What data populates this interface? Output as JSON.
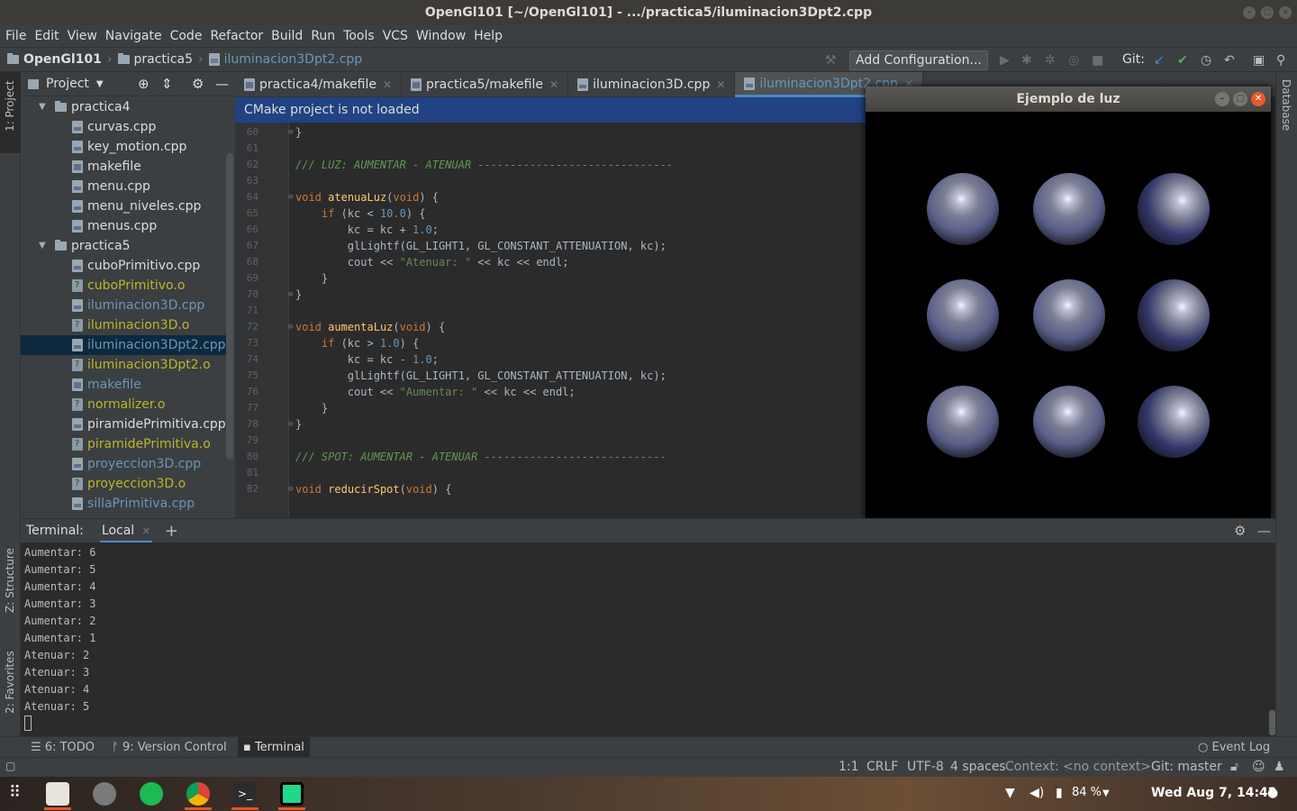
{
  "window": {
    "title": "OpenGl101 [~/OpenGl101] - .../practica5/iluminacion3Dpt2.cpp"
  },
  "menu": [
    "File",
    "Edit",
    "View",
    "Navigate",
    "Code",
    "Refactor",
    "Build",
    "Run",
    "Tools",
    "VCS",
    "Window",
    "Help"
  ],
  "breadcrumb": {
    "project": "OpenGl101",
    "folder": "practica5",
    "file": "iluminacion3Dpt2.cpp"
  },
  "toolbar": {
    "add_config": "Add Configuration...",
    "git_label": "Git:"
  },
  "side_tabs": {
    "project": "1: Project",
    "structure": "Z: Structure",
    "favorites": "2: Favorites",
    "database": "Database"
  },
  "project_panel": {
    "title": "Project",
    "tree": [
      {
        "label": "practica4",
        "kind": "folder",
        "color": "white",
        "depth": 0
      },
      {
        "label": "curvas.cpp",
        "kind": "cpp",
        "color": "white",
        "depth": 1
      },
      {
        "label": "key_motion.cpp",
        "kind": "cpp",
        "color": "white",
        "depth": 1
      },
      {
        "label": "makefile",
        "kind": "mk",
        "color": "white",
        "depth": 1
      },
      {
        "label": "menu.cpp",
        "kind": "cpp",
        "color": "white",
        "depth": 1
      },
      {
        "label": "menu_niveles.cpp",
        "kind": "cpp",
        "color": "white",
        "depth": 1
      },
      {
        "label": "menus.cpp",
        "kind": "cpp",
        "color": "white",
        "depth": 1
      },
      {
        "label": "practica5",
        "kind": "folder",
        "color": "white",
        "depth": 0
      },
      {
        "label": "cuboPrimitivo.cpp",
        "kind": "cpp",
        "color": "white",
        "depth": 1
      },
      {
        "label": "cuboPrimitivo.o",
        "kind": "obj",
        "color": "yellow",
        "depth": 1
      },
      {
        "label": "iluminacion3D.cpp",
        "kind": "cpp",
        "color": "blue",
        "depth": 1
      },
      {
        "label": "iluminacion3D.o",
        "kind": "obj",
        "color": "yellow",
        "depth": 1
      },
      {
        "label": "iluminacion3Dpt2.cpp",
        "kind": "cpp",
        "color": "blue",
        "depth": 1,
        "selected": true
      },
      {
        "label": "iluminacion3Dpt2.o",
        "kind": "obj",
        "color": "yellow",
        "depth": 1
      },
      {
        "label": "makefile",
        "kind": "mk",
        "color": "blue",
        "depth": 1
      },
      {
        "label": "normalizer.o",
        "kind": "obj",
        "color": "yellow",
        "depth": 1
      },
      {
        "label": "piramidePrimitiva.cpp",
        "kind": "cpp",
        "color": "white",
        "depth": 1
      },
      {
        "label": "piramidePrimitiva.o",
        "kind": "obj",
        "color": "yellow",
        "depth": 1
      },
      {
        "label": "proyeccion3D.cpp",
        "kind": "cpp",
        "color": "blue",
        "depth": 1
      },
      {
        "label": "proyeccion3D.o",
        "kind": "obj",
        "color": "yellow",
        "depth": 1
      },
      {
        "label": "sillaPrimitiva.cpp",
        "kind": "cpp",
        "color": "blue",
        "depth": 1
      }
    ]
  },
  "tabs": [
    {
      "label": "practica4/makefile",
      "active": false
    },
    {
      "label": "practica5/makefile",
      "active": false
    },
    {
      "label": "iluminacion3D.cpp",
      "active": false
    },
    {
      "label": "iluminacion3Dpt2.cpp",
      "active": true
    }
  ],
  "cmake_banner": "CMake project is not loaded",
  "editor": {
    "lines": [
      {
        "n": "60",
        "html": "}"
      },
      {
        "n": "61",
        "html": ""
      },
      {
        "n": "62",
        "html": "<span class='cmt'>/// LUZ: AUMENTAR - ATENUAR ------------------------------</span>"
      },
      {
        "n": "63",
        "html": ""
      },
      {
        "n": "64",
        "html": "<span class='kw'>void</span> <span class='fn'>atenuaLuz</span>(<span class='kw'>void</span>) {"
      },
      {
        "n": "65",
        "html": "    <span class='kw'>if</span> (kc &lt; <span class='num'>10.0</span>) {"
      },
      {
        "n": "66",
        "html": "        kc = kc + <span class='num'>1.0</span>;"
      },
      {
        "n": "67",
        "html": "        glLightf(GL_LIGHT1, GL_CONSTANT_ATTENUATION, kc);"
      },
      {
        "n": "68",
        "html": "        cout &lt;&lt; <span class='str'>\"Atenuar: \"</span> &lt;&lt; kc &lt;&lt; endl;"
      },
      {
        "n": "69",
        "html": "    }"
      },
      {
        "n": "70",
        "html": "}"
      },
      {
        "n": "71",
        "html": ""
      },
      {
        "n": "72",
        "html": "<span class='kw'>void</span> <span class='fn'>aumentaLuz</span>(<span class='kw'>void</span>) {"
      },
      {
        "n": "73",
        "html": "    <span class='kw'>if</span> (kc &gt; <span class='num'>1.0</span>) {"
      },
      {
        "n": "74",
        "html": "        kc = kc - <span class='num'>1.0</span>;"
      },
      {
        "n": "75",
        "html": "        glLightf(GL_LIGHT1, GL_CONSTANT_ATTENUATION, kc);"
      },
      {
        "n": "76",
        "html": "        cout &lt;&lt; <span class='str'>\"Aumentar: \"</span> &lt;&lt; kc &lt;&lt; endl;"
      },
      {
        "n": "77",
        "html": "    }"
      },
      {
        "n": "78",
        "html": "}"
      },
      {
        "n": "79",
        "html": ""
      },
      {
        "n": "80",
        "html": "<span class='cmt'>/// SPOT: AUMENTAR - ATENUAR ----------------------------</span>"
      },
      {
        "n": "81",
        "html": ""
      },
      {
        "n": "82",
        "html": "<span class='kw'>void</span> <span class='fn'>reducirSpot</span>(<span class='kw'>void</span>) {"
      }
    ]
  },
  "gl_window": {
    "title": "Ejemplo de luz",
    "spheres": 9
  },
  "terminal": {
    "label": "Terminal:",
    "tab": "Local",
    "lines": [
      "Aumentar: 6",
      "Aumentar: 5",
      "Aumentar: 4",
      "Aumentar: 3",
      "Aumentar: 2",
      "Aumentar: 1",
      "Atenuar: 2",
      "Atenuar: 3",
      "Atenuar: 4",
      "Atenuar: 5"
    ]
  },
  "tool_tabs": {
    "todo": "6: TODO",
    "vcs": "9: Version Control",
    "terminal": "Terminal",
    "event_log": "Event Log"
  },
  "status": {
    "position": "1:1",
    "line_sep": "CRLF",
    "encoding": "UTF-8",
    "indent": "4 spaces",
    "context": "Context: <no context>",
    "git": "Git: master"
  },
  "taskbar": {
    "battery": "84 %",
    "datetime": "Wed Aug  7, 14:42"
  },
  "colors": {
    "accent": "#4a88c7",
    "ubuntu_orange": "#e95420",
    "banner": "#214283"
  }
}
